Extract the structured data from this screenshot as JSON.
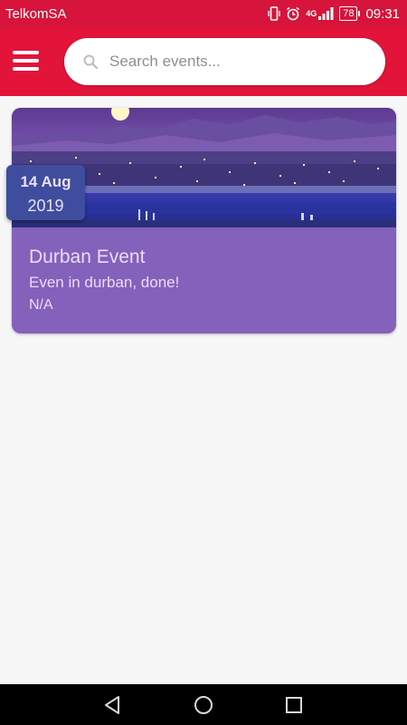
{
  "status_bar": {
    "carrier": "TelkomSA",
    "network": "4G",
    "battery": "78",
    "time": "09:31",
    "icons": [
      "vibrate-icon",
      "alarm-icon",
      "signal-icon",
      "battery-icon"
    ]
  },
  "app_bar": {
    "menu_icon": "hamburger-menu-icon",
    "search": {
      "placeholder": "Search events...",
      "value": "",
      "icon": "search-icon"
    }
  },
  "events": [
    {
      "date_day": "14 Aug",
      "date_year": "2019",
      "title": "Durban Event",
      "description": "Even in durban, done!",
      "meta": "N/A"
    }
  ],
  "nav_bar": {
    "icons": [
      "back-icon",
      "home-icon",
      "recents-icon"
    ]
  },
  "colors": {
    "status_bar": "#d7143b",
    "app_bar": "#e2143a",
    "card": "#8461bb",
    "date_badge": "#3f4d9e",
    "background": "#f7f7f7"
  }
}
